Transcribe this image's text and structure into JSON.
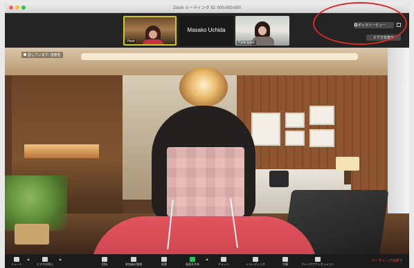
{
  "window": {
    "title": "Zoom ミーティング ID: 000-000-000"
  },
  "thumbnail_strip": {
    "participants": [
      {
        "name": "Host"
      },
      {
        "name": "Masako Uchida"
      },
      {
        "name": "Participant"
      }
    ]
  },
  "controls": {
    "view_button_label": "ギャラリービュー",
    "hide_button_label": "ビデオ非表示"
  },
  "main_video": {
    "speaker_label": "話しています: 話者名"
  },
  "toolbar": {
    "items": [
      {
        "label": "ミュート",
        "icon": "microphone-icon"
      },
      {
        "label": "ビデオの停止",
        "icon": "video-camera-icon"
      },
      {
        "label": "招待",
        "icon": "invite-icon"
      },
      {
        "label": "参加者の管理",
        "icon": "participants-icon"
      },
      {
        "label": "投票",
        "icon": "polling-icon"
      },
      {
        "label": "画面を共有",
        "icon": "share-screen-icon"
      },
      {
        "label": "チャット",
        "icon": "chat-icon"
      },
      {
        "label": "レコーディング",
        "icon": "record-icon"
      },
      {
        "label": "字幕",
        "icon": "closed-caption-icon"
      },
      {
        "label": "ブレイクアウトセッション",
        "icon": "breakout-rooms-icon"
      }
    ],
    "end_label": "ミーティングの終了"
  },
  "colors": {
    "window_bg": "#1c1c1e",
    "share_green": "#2dbf5b",
    "end_red": "#ff4a4a",
    "annotation_red": "#d92a2a",
    "active_speaker_border": "#c7c82b"
  }
}
